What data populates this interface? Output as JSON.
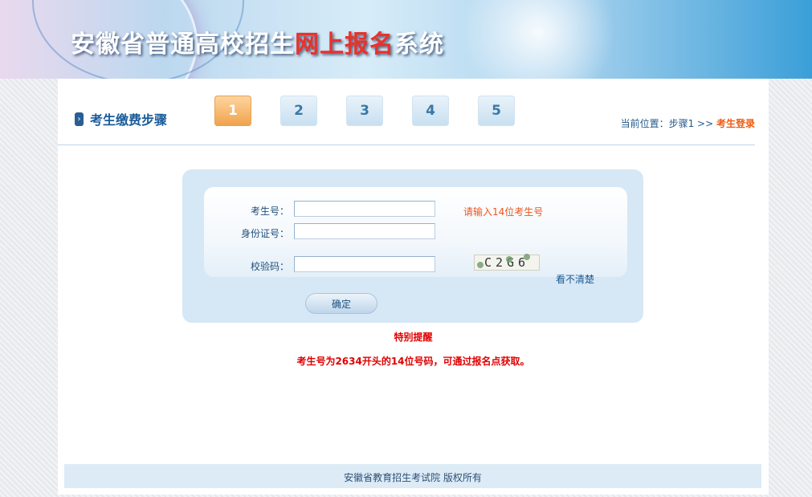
{
  "banner": {
    "title_part1": "安徽省普通高校招生",
    "title_part2": "网上报名",
    "title_part3": "系统"
  },
  "steps": {
    "heading": "考生缴费步骤",
    "tabs": [
      {
        "label": "1",
        "active": true
      },
      {
        "label": "2",
        "active": false
      },
      {
        "label": "3",
        "active": false
      },
      {
        "label": "4",
        "active": false
      },
      {
        "label": "5",
        "active": false
      }
    ],
    "location_prefix": "当前位置：步骤1 >> ",
    "location_current": "考生登录"
  },
  "form": {
    "exam_no_label": "考生号：",
    "exam_no_value": "",
    "exam_no_hint": "请输入14位考生号",
    "id_label": "身份证号：",
    "id_value": "",
    "captcha_label": "校验码：",
    "captcha_value": "",
    "captcha_text": "C2G6",
    "refresh_label": "看不清楚",
    "submit_label": "确定"
  },
  "notice": {
    "title": "特别提醒",
    "text": "考生号为2634开头的14位号码，可通过报名点获取。"
  },
  "footer": {
    "text": "安徽省教育招生考试院 版权所有"
  },
  "colors": {
    "accent_blue": "#1a5c9a",
    "warning_red": "#e00000",
    "hint_orange": "#f0531c",
    "active_step": "#f0a24a"
  }
}
